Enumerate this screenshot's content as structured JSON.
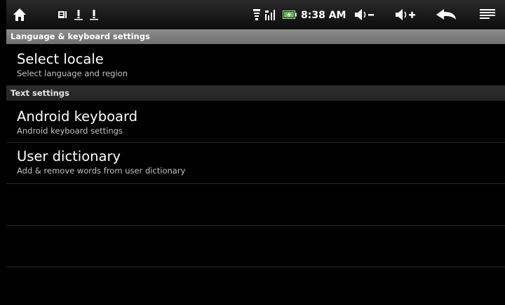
{
  "status_bar": {
    "time": "8:38 AM",
    "icons": [
      "home-icon",
      "notification-storage-icon",
      "warning-icon",
      "warning-icon",
      "wifi-icon",
      "signal-icon",
      "battery-charging-icon",
      "volume-down-icon",
      "volume-up-icon",
      "back-icon",
      "menu-icon"
    ]
  },
  "sections": [
    {
      "header": "Language & keyboard settings",
      "items": [
        {
          "title": "Select locale",
          "summary": "Select language and region"
        }
      ]
    },
    {
      "header": "Text settings",
      "items": [
        {
          "title": "Android keyboard",
          "summary": "Android keyboard settings"
        },
        {
          "title": "User dictionary",
          "summary": "Add & remove words from user dictionary"
        }
      ]
    }
  ],
  "colors": {
    "background": "#000000",
    "header_light": "#7e7e7e",
    "header_dark": "#2a2a2a",
    "summary_text": "#c4c4c4",
    "battery_accent": "#5fc24a"
  }
}
